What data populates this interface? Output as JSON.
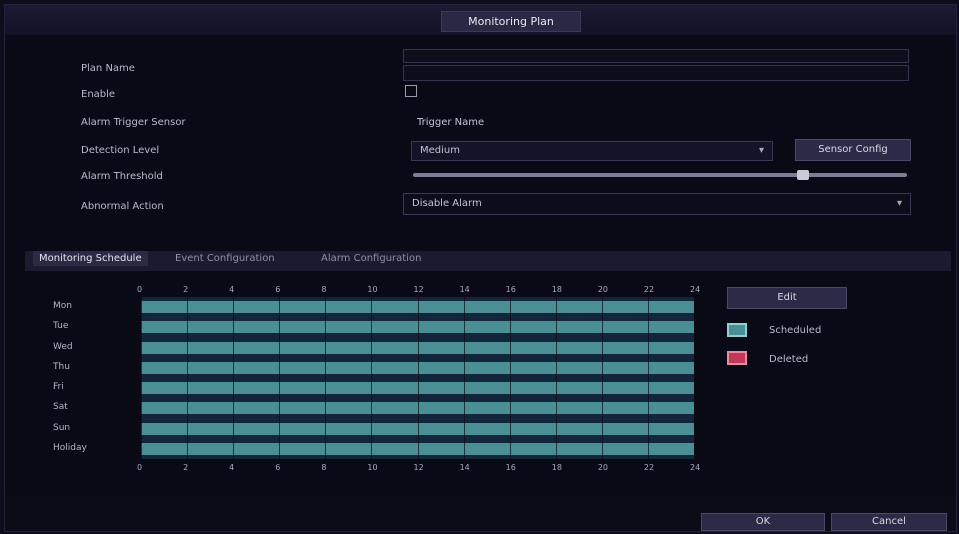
{
  "window": {
    "title": "Monitoring Plan"
  },
  "form": {
    "fields": [
      {
        "label": "Plan Name",
        "value": ""
      },
      {
        "label": "Enable",
        "value": "Off"
      },
      {
        "label": "Alarm Trigger Sensor",
        "value": "Trigger Name"
      },
      {
        "label": "Detection Level",
        "value": "Medium"
      },
      {
        "label": "Alarm Threshold",
        "value": ""
      },
      {
        "label": "Abnormal Action",
        "value": "Disable Alarm"
      }
    ],
    "sensor_button": "Sensor Config"
  },
  "tabs": [
    "Monitoring Schedule",
    "Event Configuration",
    "Alarm Configuration"
  ],
  "schedule": {
    "days": [
      "Mon",
      "Tue",
      "Wed",
      "Thu",
      "Fri",
      "Sat",
      "Sun",
      "Holiday"
    ],
    "hours": [
      "0",
      "2",
      "4",
      "6",
      "8",
      "10",
      "12",
      "14",
      "16",
      "18",
      "20",
      "22",
      "24"
    ],
    "legend": {
      "edit": "Edit",
      "scheduled": "Scheduled",
      "deleted": "Deleted"
    }
  },
  "colors": {
    "scheduled": "#4a8f94",
    "deleted": "#c0395a",
    "background": "#0a0a17"
  },
  "footer": {
    "ok": "OK",
    "cancel": "Cancel"
  }
}
